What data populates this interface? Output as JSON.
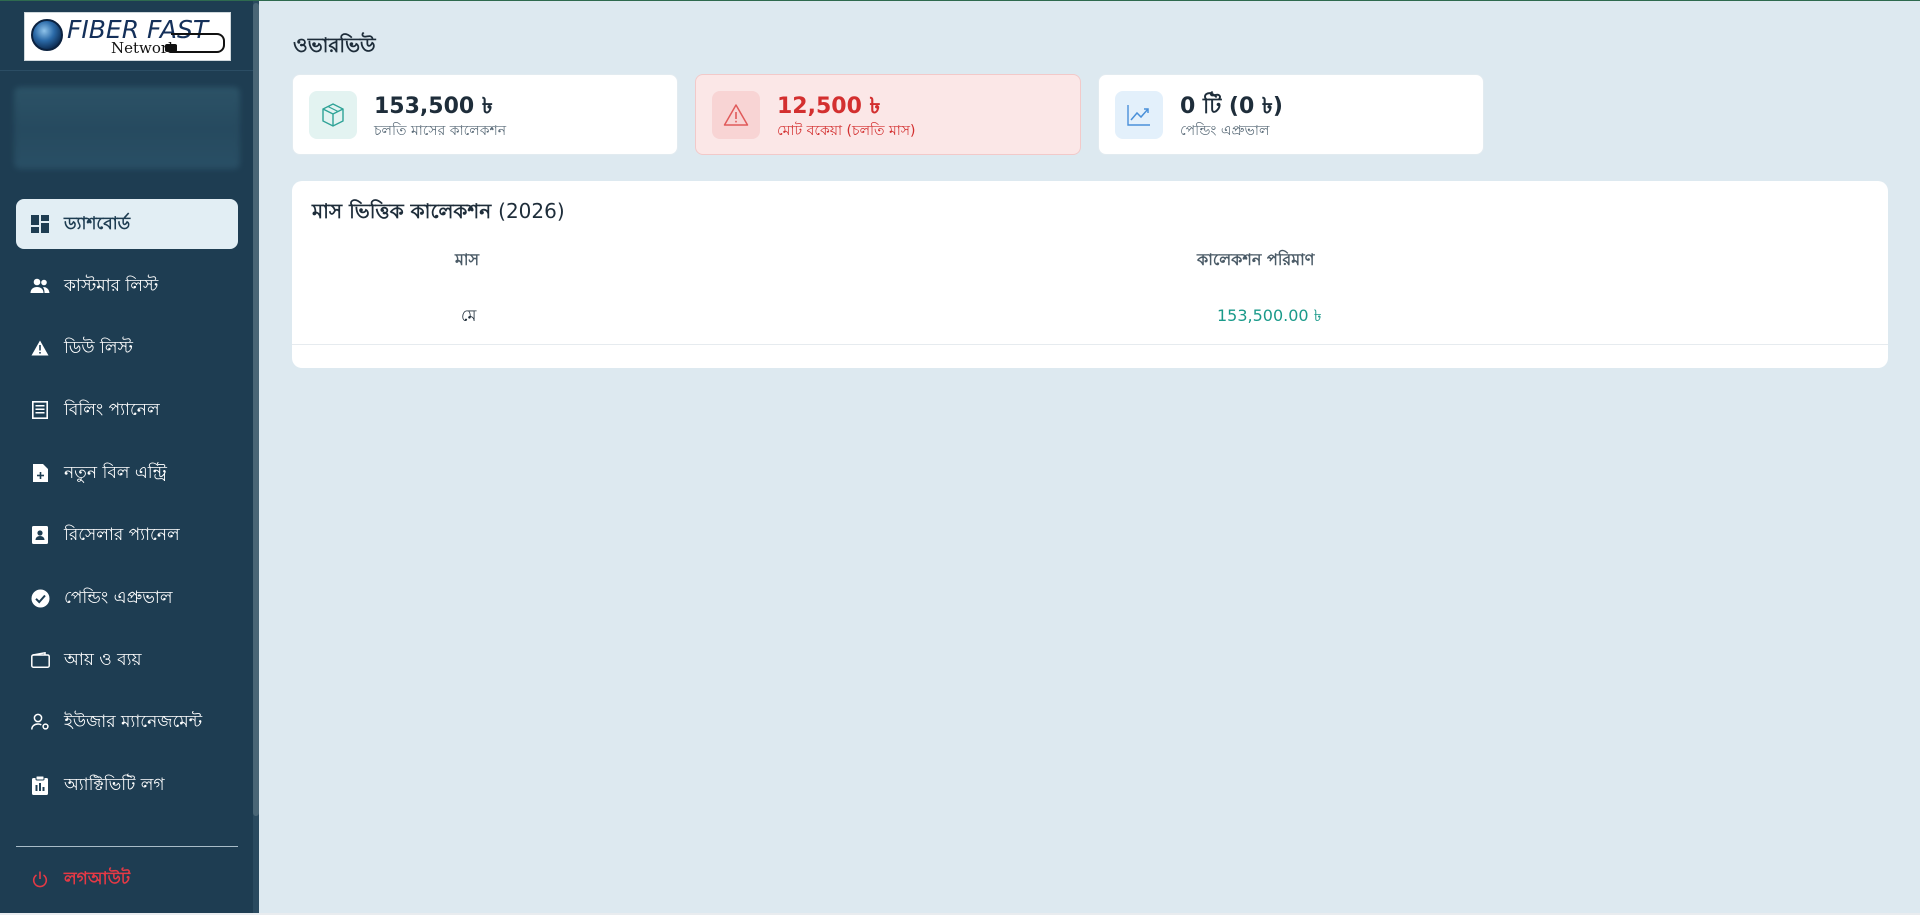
{
  "logo": {
    "title": "FIBER FAST",
    "subtitle": "Network"
  },
  "sidebar": {
    "items": [
      {
        "label": "ড্যাশবোর্ড",
        "icon": "dashboard-icon",
        "active": true
      },
      {
        "label": "কাস্টমার লিস্ট",
        "icon": "users-icon",
        "active": false
      },
      {
        "label": "ডিউ লিস্ট",
        "icon": "warning-icon",
        "active": false
      },
      {
        "label": "বিলিং প্যানেল",
        "icon": "receipt-icon",
        "active": false
      },
      {
        "label": "নতুন বিল এন্ট্রি",
        "icon": "new-document-icon",
        "active": false
      },
      {
        "label": "রিসেলার প্যানেল",
        "icon": "contact-book-icon",
        "active": false
      },
      {
        "label": "পেন্ডিং এপ্রুভাল",
        "icon": "check-circle-icon",
        "active": false
      },
      {
        "label": "আয় ও ব্যয়",
        "icon": "wallet-icon",
        "active": false
      },
      {
        "label": "ইউজার ম্যানেজমেন্ট",
        "icon": "user-settings-icon",
        "active": false
      },
      {
        "label": "অ্যাক্টিভিটি লগ",
        "icon": "clipboard-icon",
        "active": false
      }
    ],
    "logout_label": "লগআউট"
  },
  "main": {
    "title": "ওভারভিউ",
    "stats": [
      {
        "value": "153,500 ৳",
        "label": "চলতি মাসের কালেকশন",
        "icon": "box-icon",
        "variant": "default"
      },
      {
        "value": "12,500 ৳",
        "label": "মোট বকেয়া (চলতি মাস)",
        "icon": "warning-icon",
        "variant": "danger"
      },
      {
        "value": "0 টি (0 ৳)",
        "label": "পেন্ডিং এপ্রুভাল",
        "icon": "trend-chart-icon",
        "variant": "default"
      }
    ],
    "monthly": {
      "title": "মাস ভিত্তিক কালেকশন",
      "year": "(2026)",
      "columns": [
        "মাস",
        "কালেকশন পরিমাণ"
      ],
      "rows": [
        {
          "month": "মে",
          "amount": "153,500.00 ৳"
        }
      ]
    }
  },
  "colors": {
    "sidebar_bg": "#1e3d52",
    "page_bg": "#dde9f0",
    "danger": "#d32f2f",
    "accent_teal": "#1a9a8a",
    "logout": "#e53945"
  }
}
